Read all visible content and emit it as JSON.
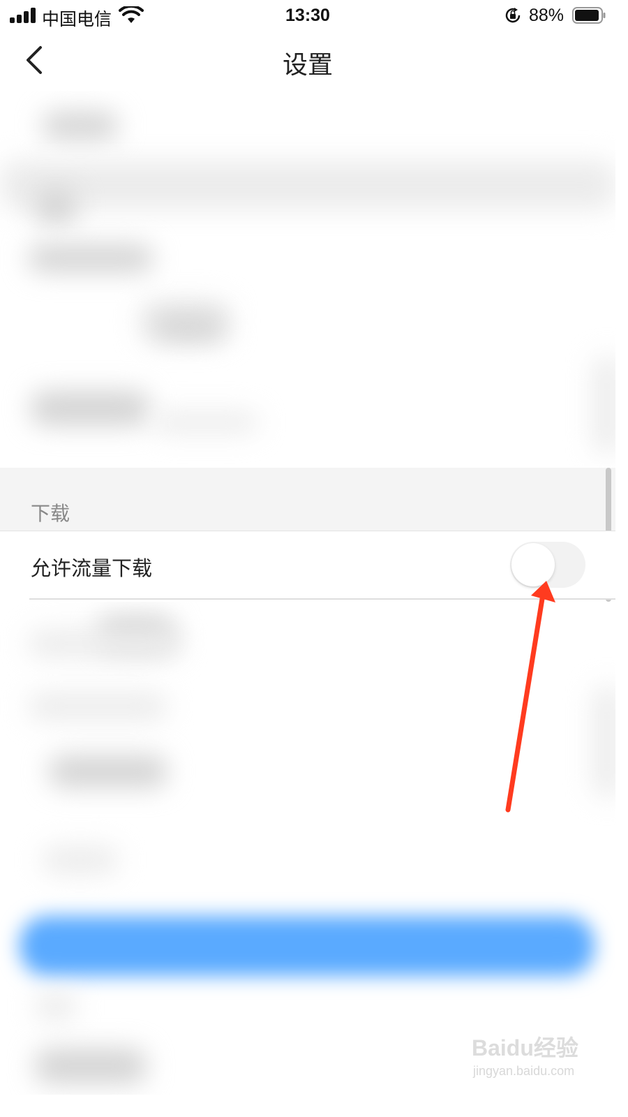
{
  "status_bar": {
    "carrier": "中国电信",
    "time": "13:30",
    "battery_percent": "88%"
  },
  "nav": {
    "title": "设置",
    "back_icon": "chevron-left-icon"
  },
  "section": {
    "title": "下载"
  },
  "settings": {
    "allow_data_download": {
      "label": "允许流量下载",
      "enabled": false
    }
  },
  "watermark": {
    "brand": "Baidu经验",
    "url": "jingyan.baidu.com"
  },
  "colors": {
    "annotation_arrow": "#ff3b1f",
    "blurred_button": "#5aaaff",
    "section_bg": "#f4f4f4"
  }
}
